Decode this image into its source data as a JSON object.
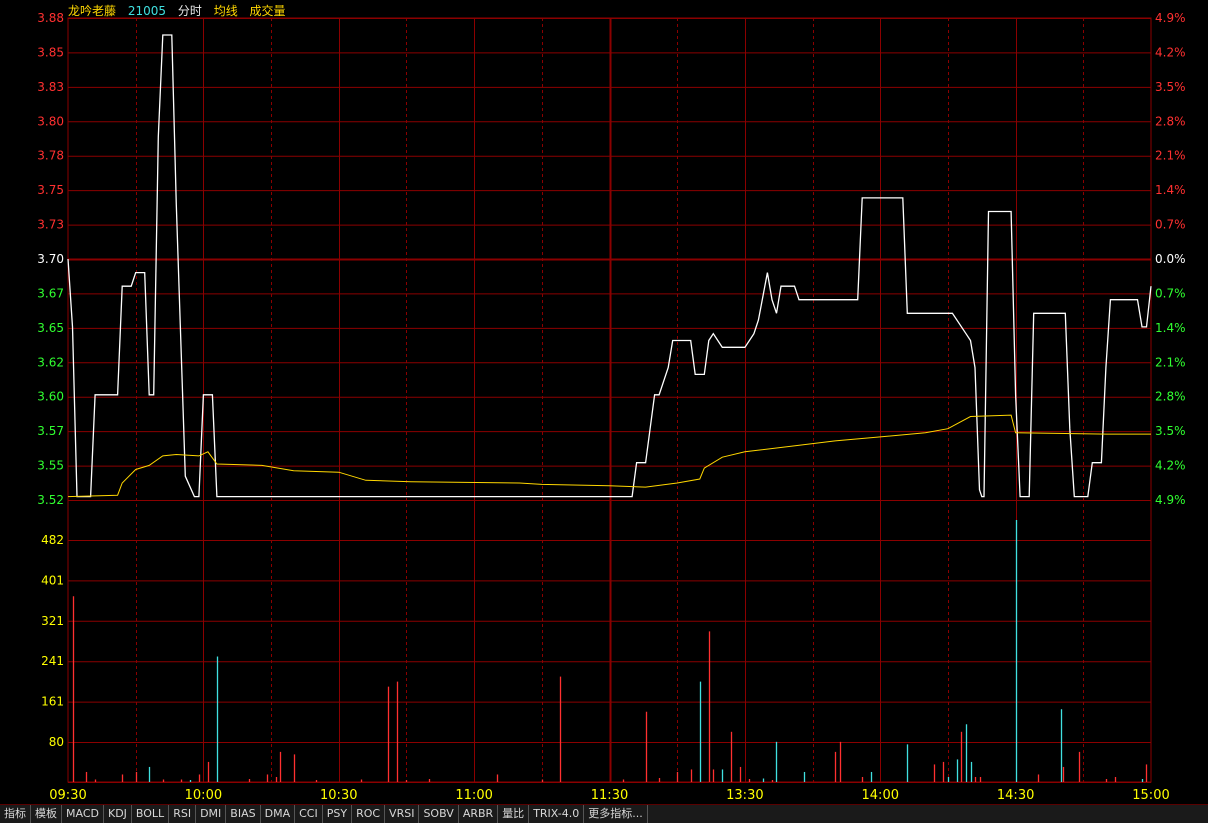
{
  "header": {
    "name": "龙吟老藤",
    "code": "21005",
    "label_fenshi": "分时",
    "label_avg": "均线",
    "label_vol": "成交量"
  },
  "colors": {
    "price_line": "#ffffff",
    "avg_line": "#ffd700",
    "grid": "#8b0000",
    "axis_up": "#ff3030",
    "axis_down": "#30ff30",
    "axis_neutral": "#ffffff",
    "vol_label": "#ffff00",
    "vol_up": "#ff3030",
    "vol_down": "#40e0e0",
    "time_label": "#ffff00"
  },
  "tabs": [
    "指标",
    "模板",
    "MACD",
    "KDJ",
    "BOLL",
    "RSI",
    "DMI",
    "BIAS",
    "DMA",
    "CCI",
    "PSY",
    "ROC",
    "VRSI",
    "SOBV",
    "ARBR",
    "量比",
    "TRIX-4.0",
    "更多指标..."
  ],
  "chart_data": {
    "type": "line",
    "price_ticks": [
      "3.88",
      "3.85",
      "3.83",
      "3.80",
      "3.78",
      "3.75",
      "3.73",
      "3.70",
      "3.67",
      "3.65",
      "3.62",
      "3.60",
      "3.57",
      "3.55",
      "3.52"
    ],
    "pct_ticks": [
      "4.9%",
      "4.2%",
      "3.5%",
      "2.8%",
      "2.1%",
      "1.4%",
      "0.7%",
      "0.0%",
      "0.7%",
      "1.4%",
      "2.1%",
      "2.8%",
      "3.5%",
      "4.2%",
      "4.9%"
    ],
    "price_range": [
      3.5225,
      3.8775
    ],
    "prev_close": 3.7,
    "volume_ticks": [
      "482",
      "401",
      "321",
      "241",
      "161",
      "80"
    ],
    "volume_range": [
      0,
      522
    ],
    "time_labels": [
      "09:30",
      "10:00",
      "10:30",
      "11:00",
      "11:30",
      "13:30",
      "14:00",
      "14:30",
      "15:00"
    ],
    "x_minutes": [
      0,
      240
    ],
    "series": [
      {
        "points": [
          [
            0,
            3.7
          ],
          [
            1,
            3.65
          ],
          [
            2,
            3.525
          ],
          [
            5,
            3.525
          ],
          [
            6,
            3.6
          ],
          [
            11,
            3.6
          ],
          [
            12,
            3.68
          ],
          [
            14,
            3.68
          ],
          [
            15,
            3.69
          ],
          [
            17,
            3.69
          ],
          [
            18,
            3.6
          ],
          [
            19,
            3.6
          ],
          [
            20,
            3.79
          ],
          [
            21,
            3.865
          ],
          [
            23,
            3.865
          ],
          [
            24,
            3.74
          ],
          [
            26,
            3.54
          ],
          [
            28,
            3.525
          ],
          [
            29,
            3.525
          ],
          [
            30,
            3.6
          ],
          [
            32,
            3.6
          ],
          [
            33,
            3.525
          ],
          [
            125,
            3.525
          ],
          [
            126,
            3.55
          ],
          [
            128,
            3.55
          ],
          [
            130,
            3.6
          ],
          [
            131,
            3.6
          ],
          [
            133,
            3.62
          ],
          [
            134,
            3.64
          ],
          [
            138,
            3.64
          ],
          [
            139,
            3.615
          ],
          [
            141,
            3.615
          ],
          [
            142,
            3.64
          ],
          [
            143,
            3.645
          ],
          [
            145,
            3.635
          ],
          [
            150,
            3.635
          ],
          [
            152,
            3.645
          ],
          [
            153,
            3.655
          ],
          [
            155,
            3.69
          ],
          [
            156,
            3.67
          ],
          [
            157,
            3.66
          ],
          [
            158,
            3.68
          ],
          [
            161,
            3.68
          ],
          [
            162,
            3.67
          ],
          [
            175,
            3.67
          ],
          [
            176,
            3.745
          ],
          [
            185,
            3.745
          ],
          [
            186,
            3.66
          ],
          [
            196,
            3.66
          ],
          [
            199,
            3.645
          ],
          [
            200,
            3.64
          ],
          [
            201,
            3.62
          ],
          [
            202,
            3.53
          ],
          [
            202.5,
            3.525
          ],
          [
            203,
            3.525
          ],
          [
            204,
            3.735
          ],
          [
            209,
            3.735
          ],
          [
            210,
            3.6
          ],
          [
            211,
            3.525
          ],
          [
            213,
            3.525
          ],
          [
            214,
            3.66
          ],
          [
            221,
            3.66
          ],
          [
            222,
            3.575
          ],
          [
            223,
            3.525
          ],
          [
            226,
            3.525
          ],
          [
            227,
            3.55
          ],
          [
            229,
            3.55
          ],
          [
            230,
            3.62
          ],
          [
            231,
            3.67
          ],
          [
            237,
            3.67
          ],
          [
            238,
            3.65
          ],
          [
            239,
            3.65
          ],
          [
            240,
            3.68
          ]
        ]
      },
      {
        "points": [
          [
            0,
            3.525
          ],
          [
            11,
            3.526
          ],
          [
            12,
            3.535
          ],
          [
            15,
            3.545
          ],
          [
            18,
            3.548
          ],
          [
            21,
            3.555
          ],
          [
            24,
            3.556
          ],
          [
            29,
            3.555
          ],
          [
            31,
            3.558
          ],
          [
            33,
            3.549
          ],
          [
            43,
            3.548
          ],
          [
            50,
            3.544
          ],
          [
            60,
            3.543
          ],
          [
            66,
            3.537
          ],
          [
            76,
            3.536
          ],
          [
            100,
            3.535
          ],
          [
            105,
            3.534
          ],
          [
            120,
            3.533
          ],
          [
            128,
            3.532
          ],
          [
            135,
            3.535
          ],
          [
            140,
            3.538
          ],
          [
            141,
            3.546
          ],
          [
            145,
            3.554
          ],
          [
            150,
            3.558
          ],
          [
            160,
            3.562
          ],
          [
            170,
            3.566
          ],
          [
            180,
            3.569
          ],
          [
            190,
            3.572
          ],
          [
            195,
            3.575
          ],
          [
            200,
            3.584
          ],
          [
            209,
            3.585
          ],
          [
            210,
            3.572
          ],
          [
            230,
            3.571
          ],
          [
            240,
            3.571
          ]
        ]
      }
    ],
    "volume_bars": [
      [
        1,
        370,
        "up"
      ],
      [
        4,
        20,
        "up"
      ],
      [
        6,
        5,
        "up"
      ],
      [
        12,
        15,
        "up"
      ],
      [
        15,
        20,
        "up"
      ],
      [
        18,
        30,
        "down"
      ],
      [
        21,
        5,
        "up"
      ],
      [
        25,
        5,
        "up"
      ],
      [
        27,
        4,
        "down"
      ],
      [
        29,
        15,
        "up"
      ],
      [
        31,
        40,
        "up"
      ],
      [
        33,
        250,
        "down"
      ],
      [
        40,
        6,
        "up"
      ],
      [
        44,
        15,
        "up"
      ],
      [
        46,
        10,
        "up"
      ],
      [
        47,
        60,
        "up"
      ],
      [
        50,
        55,
        "up"
      ],
      [
        55,
        4,
        "up"
      ],
      [
        65,
        5,
        "up"
      ],
      [
        71,
        190,
        "up"
      ],
      [
        73,
        200,
        "up"
      ],
      [
        75,
        4,
        "up"
      ],
      [
        80,
        6,
        "up"
      ],
      [
        95,
        15,
        "up"
      ],
      [
        105,
        5,
        "up"
      ],
      [
        109,
        210,
        "up"
      ],
      [
        123,
        5,
        "up"
      ],
      [
        128,
        140,
        "up"
      ],
      [
        131,
        8,
        "up"
      ],
      [
        135,
        20,
        "up"
      ],
      [
        138,
        25,
        "up"
      ],
      [
        140,
        200,
        "down"
      ],
      [
        142,
        300,
        "up"
      ],
      [
        143,
        25,
        "up"
      ],
      [
        145,
        25,
        "down"
      ],
      [
        147,
        100,
        "up"
      ],
      [
        149,
        30,
        "up"
      ],
      [
        151,
        6,
        "up"
      ],
      [
        154,
        7,
        "down"
      ],
      [
        156,
        4,
        "up"
      ],
      [
        157,
        80,
        "down"
      ],
      [
        163,
        20,
        "down"
      ],
      [
        170,
        60,
        "up"
      ],
      [
        171,
        80,
        "up"
      ],
      [
        176,
        10,
        "up"
      ],
      [
        178,
        20,
        "down"
      ],
      [
        186,
        75,
        "down"
      ],
      [
        192,
        35,
        "up"
      ],
      [
        194,
        40,
        "up"
      ],
      [
        195,
        10,
        "down"
      ],
      [
        197,
        45,
        "down"
      ],
      [
        198,
        100,
        "up"
      ],
      [
        199,
        115,
        "down"
      ],
      [
        200,
        40,
        "down"
      ],
      [
        201,
        10,
        "up"
      ],
      [
        202,
        10,
        "up"
      ],
      [
        210,
        522,
        "down"
      ],
      [
        215,
        15,
        "up"
      ],
      [
        220,
        145,
        "down"
      ],
      [
        220.5,
        30,
        "up"
      ],
      [
        224,
        60,
        "up"
      ],
      [
        230,
        6,
        "up"
      ],
      [
        232,
        10,
        "up"
      ],
      [
        238,
        6,
        "down"
      ],
      [
        239,
        35,
        "up"
      ]
    ]
  }
}
